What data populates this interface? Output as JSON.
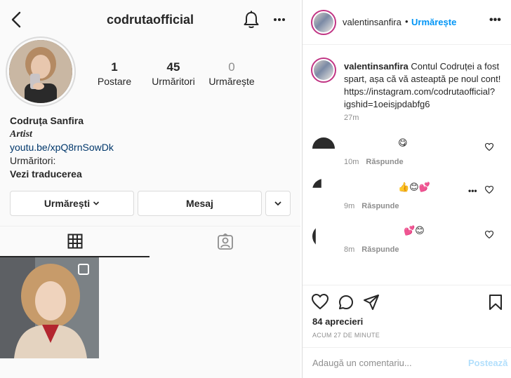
{
  "profile": {
    "username": "codrutaofficial",
    "full_name": "Codruța Sanfira",
    "category": "Artist",
    "link": "youtu.be/xpQ8rnSowDk",
    "bio_line": "Urmăritori:",
    "translate": "Vezi traducerea",
    "stats": [
      {
        "value": "1",
        "label": "Postare"
      },
      {
        "value": "45",
        "label": "Urmăritori"
      },
      {
        "value": "0",
        "label": "Urmărește"
      }
    ],
    "buttons": {
      "following": "Urmărești",
      "message": "Mesaj"
    }
  },
  "post": {
    "author": "valentinsanfira",
    "separator": "•",
    "follow": "Urmărește",
    "more": "•••",
    "caption_user": "valentinsanfira",
    "caption_text": "Contul Codruței a fost spart, așa că vă asteaptă pe noul cont! https://instagram.com/codrutaofficial?igshid=1oeisjpdabfg6",
    "caption_time": "27m",
    "comments": [
      {
        "emoji": "😋",
        "time": "10m",
        "reply": "Răspunde"
      },
      {
        "emoji": "👍😊💕",
        "time": "9m",
        "reply": "Răspunde"
      },
      {
        "emoji": "💕😊",
        "time": "8m",
        "reply": "Răspunde"
      }
    ],
    "likes": "84 aprecieri",
    "posted": "ACUM 27 DE MINUTE",
    "comment_placeholder": "Adaugă un comentariu...",
    "post_button": "Postează"
  }
}
